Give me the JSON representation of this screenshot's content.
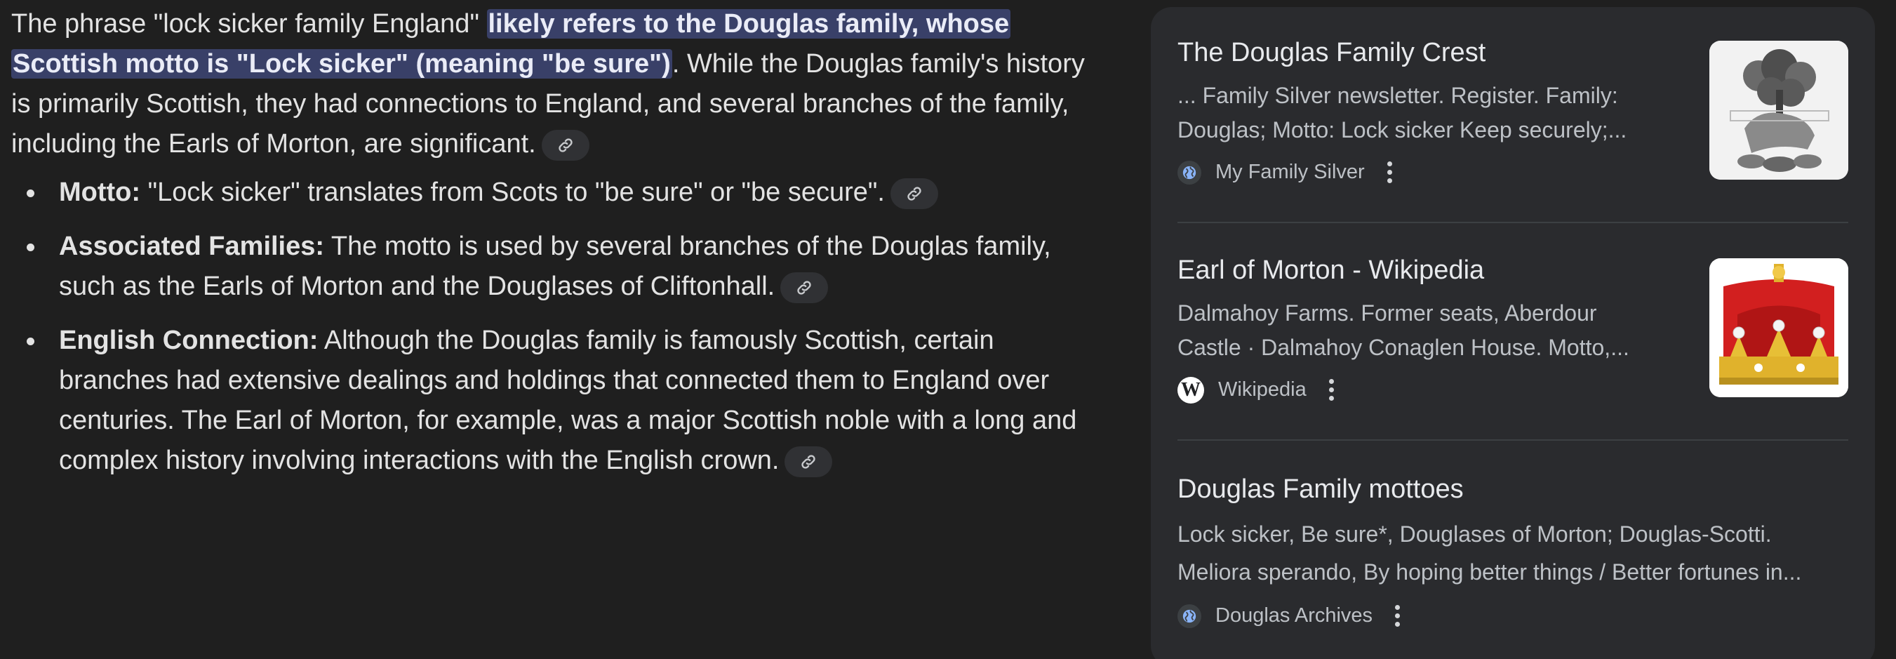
{
  "answer": {
    "intro_before": "The phrase \"lock sicker family England\" ",
    "intro_highlight": "likely refers to the Douglas family, whose Scottish motto is \"Lock sicker\" (meaning \"be sure\")",
    "intro_after": ". While the Douglas family's history is primarily Scottish, they had connections to England, and several branches of the family, including the Earls of Morton, are significant.",
    "bullets": [
      {
        "term": "Motto:",
        "text": " \"Lock sicker\" translates from Scots to \"be sure\" or \"be secure\"."
      },
      {
        "term": "Associated Families:",
        "text": " The motto is used by several branches of the Douglas family, such as the Earls of Morton and the Douglases of Cliftonhall."
      },
      {
        "term": "English Connection:",
        "text": " Although the Douglas family is famously Scottish, certain branches had extensive dealings and holdings that connected them to England over centuries. The Earl of Morton, for example, was a major Scottish noble with a long and complex history involving interactions with the English crown."
      }
    ]
  },
  "sources": [
    {
      "title": "The Douglas Family Crest",
      "snippet_line1": "... Family Silver newsletter. Register. Family:",
      "snippet_line2": "Douglas; Motto: Lock sicker Keep securely;...",
      "source": "My Family Silver",
      "icon": "globe-icon"
    },
    {
      "title": "Earl of Morton - Wikipedia",
      "snippet_line1": "Dalmahoy Farms. Former seats, Aberdour",
      "snippet_line2": "Castle · Dalmahoy Conaglen House. Motto,...",
      "source": "Wikipedia",
      "icon": "wikipedia-icon",
      "icon_letter": "W"
    },
    {
      "title": "Douglas Family mottoes",
      "snippet_line1": "Lock sicker, Be sure*, Douglases of Morton; Douglas-Scotti.",
      "snippet_line2": "Meliora sperando, By hoping better things / Better fortunes in...",
      "source": "Douglas Archives",
      "icon": "globe-icon"
    }
  ],
  "colors": {
    "background": "#1f1f1f",
    "panel": "#2a2b2e",
    "highlight": "#394068",
    "text": "#e3e3e3",
    "muted": "#bdc1c6"
  }
}
